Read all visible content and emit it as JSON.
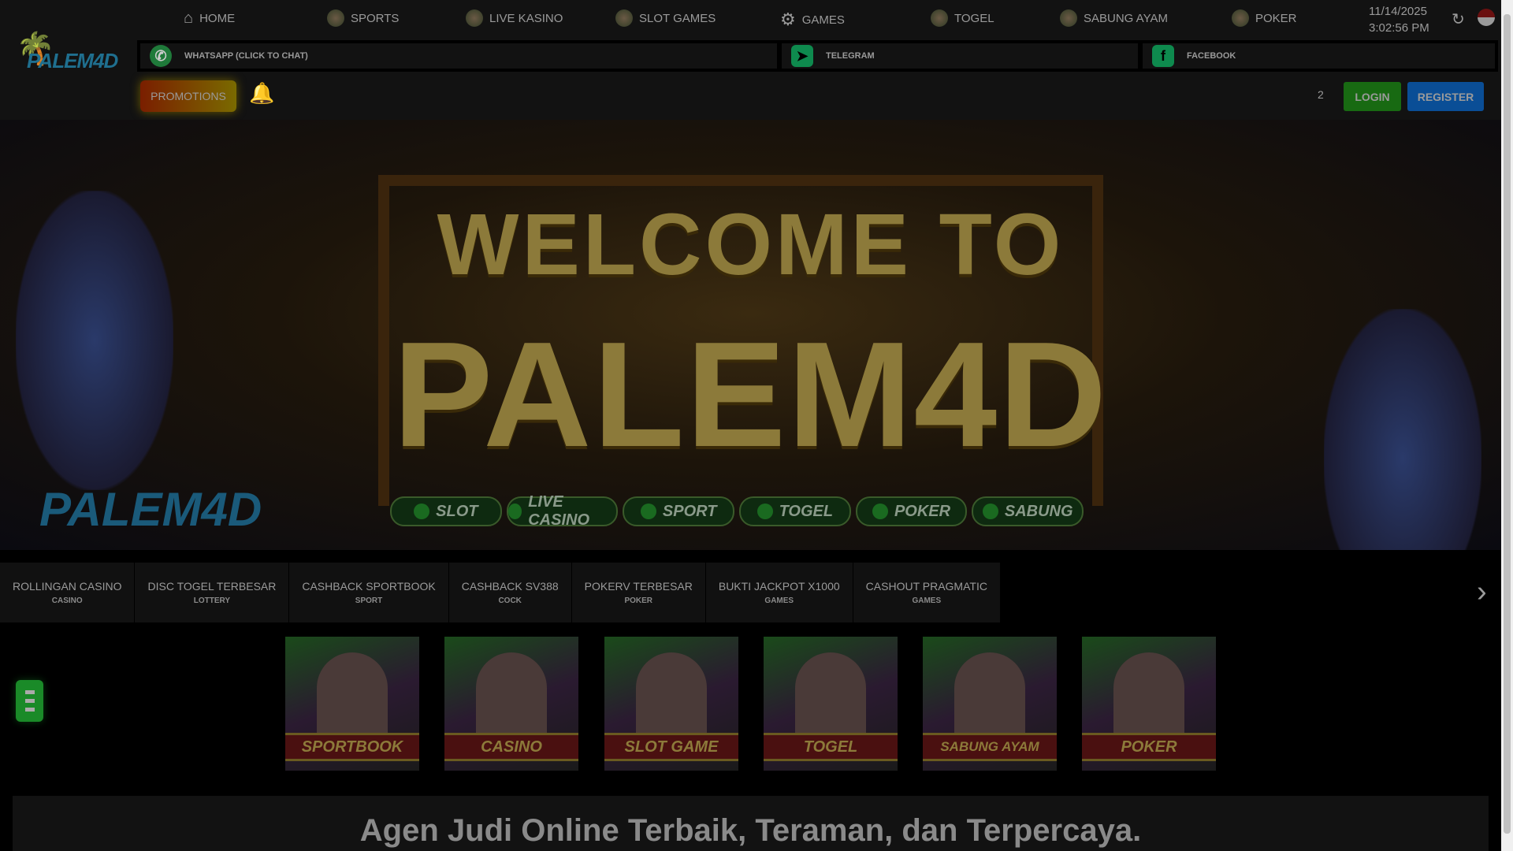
{
  "logo": {
    "text": "PALEM4D"
  },
  "nav": [
    {
      "label": "HOME",
      "icon": "home-icon"
    },
    {
      "label": "SPORTS",
      "icon": "sports-icon"
    },
    {
      "label": "LIVE KASINO",
      "icon": "live-kasino-icon"
    },
    {
      "label": "SLOT GAMES",
      "icon": "slot-games-icon"
    },
    {
      "label": "GAMES",
      "icon": "gear-icon"
    },
    {
      "label": "TOGEL",
      "icon": "togel-icon"
    },
    {
      "label": "SABUNG AYAM",
      "icon": "sabung-ayam-icon"
    },
    {
      "label": "POKER",
      "icon": "poker-icon"
    }
  ],
  "clock": {
    "date": "11/14/2025",
    "time": "3:02:56 PM"
  },
  "social": {
    "whatsapp": "WHATSAPP (CLICK TO CHAT)",
    "telegram": "TELEGRAM",
    "facebook": "FACEBOOK"
  },
  "toolbar": {
    "promotions": "PROMOTIONS",
    "notification_count": "2",
    "login": "LOGIN",
    "register": "REGISTER"
  },
  "banner": {
    "line1": "WELCOME TO",
    "line2": "PALEM4D",
    "logo": "PALEM4D",
    "pills": [
      "SLOT",
      "LIVE CASINO",
      "SPORT",
      "TOGEL",
      "POKER",
      "SABUNG"
    ]
  },
  "promo_tabs": [
    {
      "title": "ROLLINGAN CASINO",
      "sub": "CASINO"
    },
    {
      "title": "DISC TOGEL TERBESAR",
      "sub": "LOTTERY"
    },
    {
      "title": "CASHBACK SPORTBOOK",
      "sub": "SPORT"
    },
    {
      "title": "CASHBACK SV388",
      "sub": "COCK"
    },
    {
      "title": "POKERV TERBESAR",
      "sub": "POKER"
    },
    {
      "title": "BUKTI JACKPOT X1000",
      "sub": "GAMES"
    },
    {
      "title": "CASHOUT PRAGMATIC",
      "sub": "GAMES"
    }
  ],
  "tiles": [
    "SPORTBOOK",
    "CASINO",
    "SLOT GAME",
    "TOGEL",
    "SABUNG AYAM",
    "POKER"
  ],
  "content": {
    "heading": "Agen Judi Online Terbaik, Teraman, dan Terpercaya."
  }
}
